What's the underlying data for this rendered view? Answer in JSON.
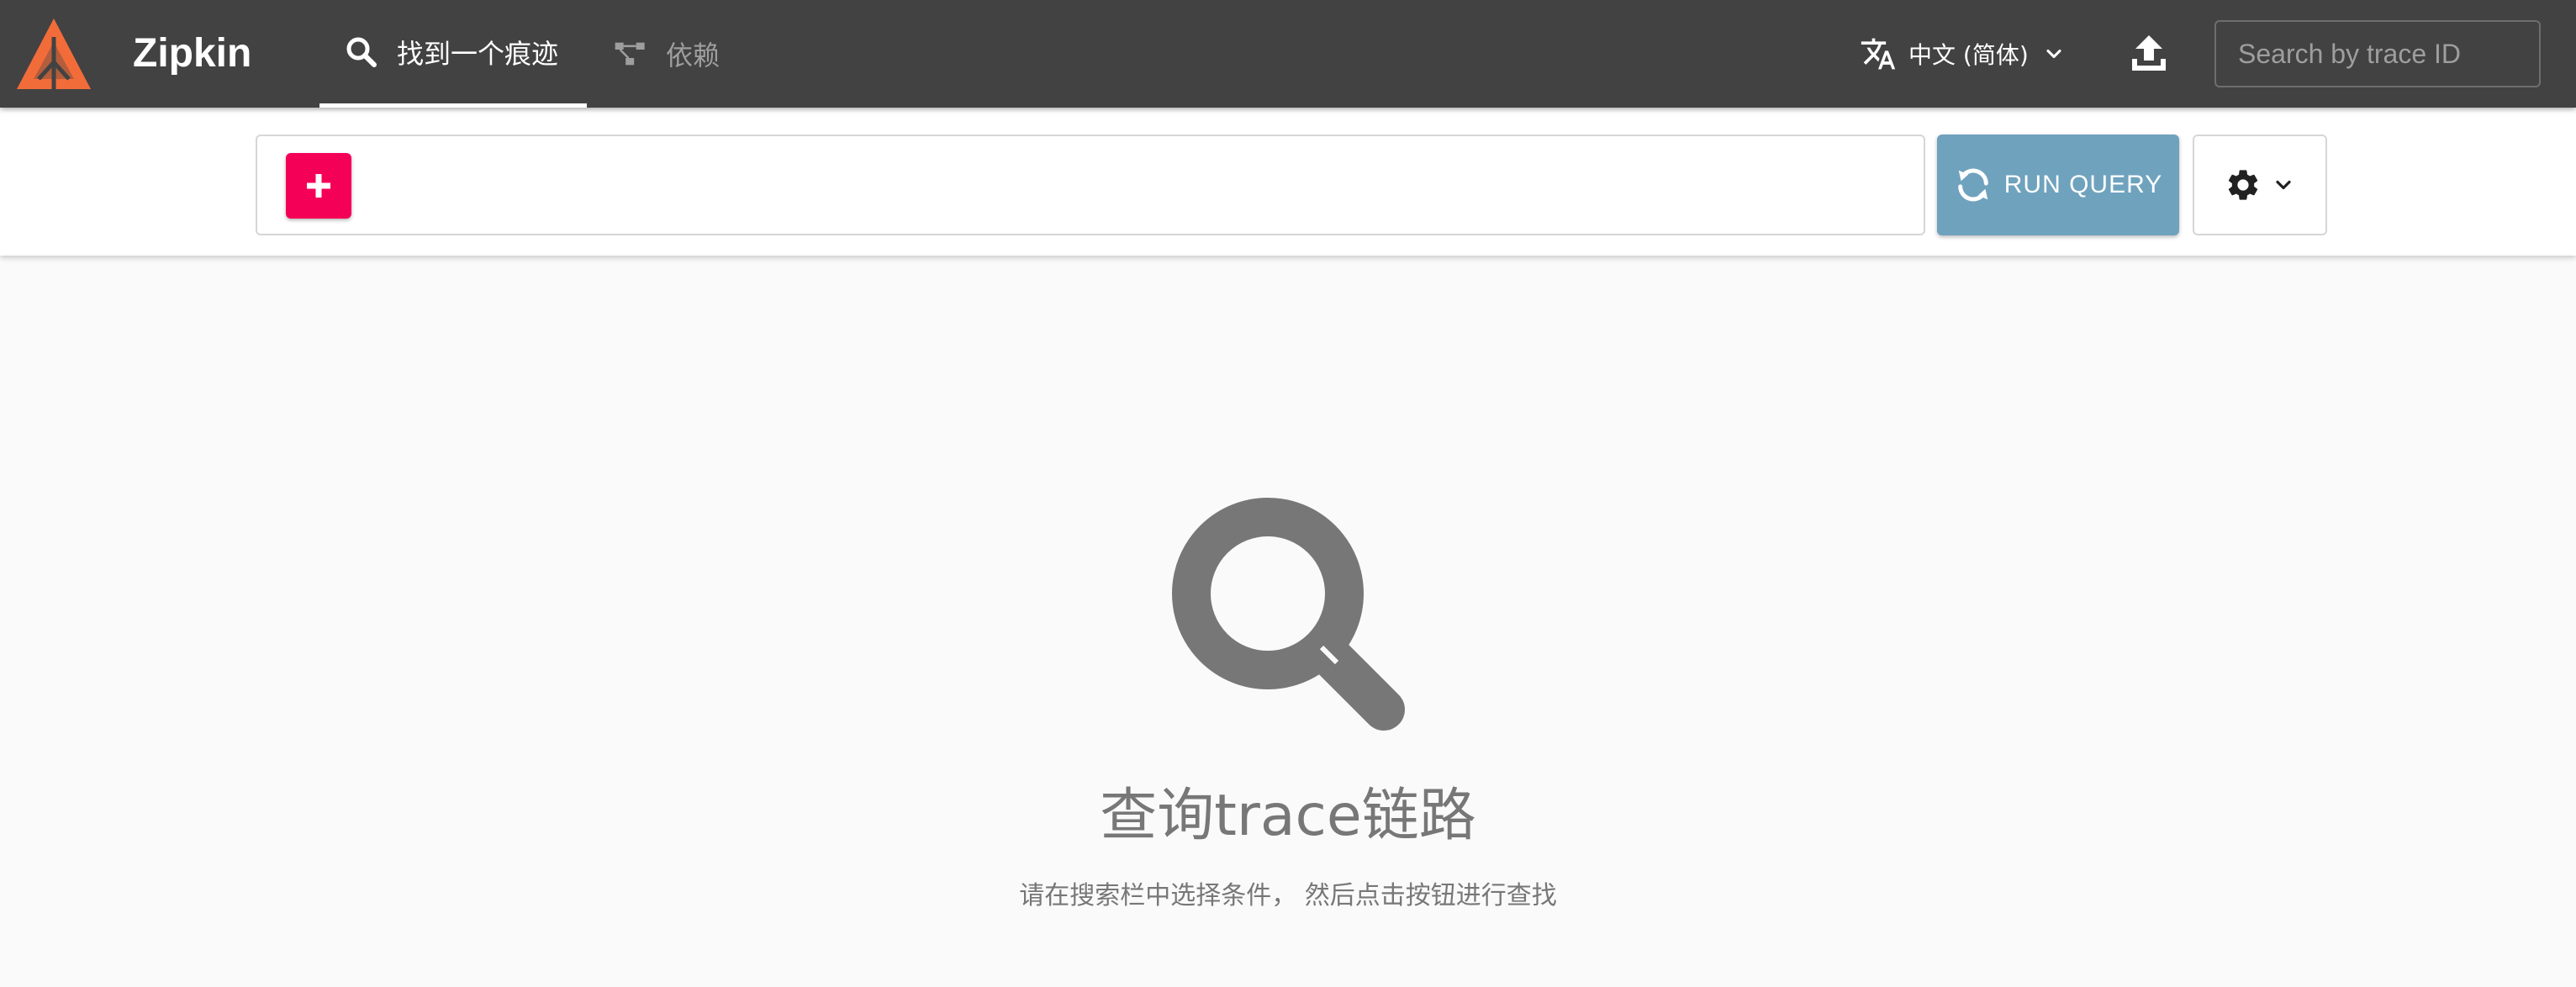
{
  "colors": {
    "header_bg": "#424242",
    "accent_pink": "#f50057",
    "run_button": "#6fa2bd",
    "logo_orange": "#f26c3a",
    "empty_text": "#777777"
  },
  "header": {
    "brand": "Zipkin",
    "logo_icon": "zipkin-logo",
    "tabs": [
      {
        "label": "找到一个痕迹",
        "icon": "search-icon",
        "active": true
      },
      {
        "label": "依赖",
        "icon": "dependency-graph-icon",
        "active": false
      }
    ],
    "language": {
      "icon": "translate-icon",
      "label": "中文 (简体)"
    },
    "upload_icon": "upload-icon",
    "trace_search": {
      "placeholder": "Search by trace ID",
      "value": ""
    }
  },
  "searchbar": {
    "add_icon": "plus-icon",
    "query_value": "",
    "run_query": {
      "label": "RUN QUERY",
      "icon": "refresh-icon"
    },
    "settings_icon": "gear-icon"
  },
  "empty_state": {
    "icon": "search-icon",
    "title": "查询trace链路",
    "subtitle": "请在搜索栏中选择条件， 然后点击按钮进行查找"
  }
}
